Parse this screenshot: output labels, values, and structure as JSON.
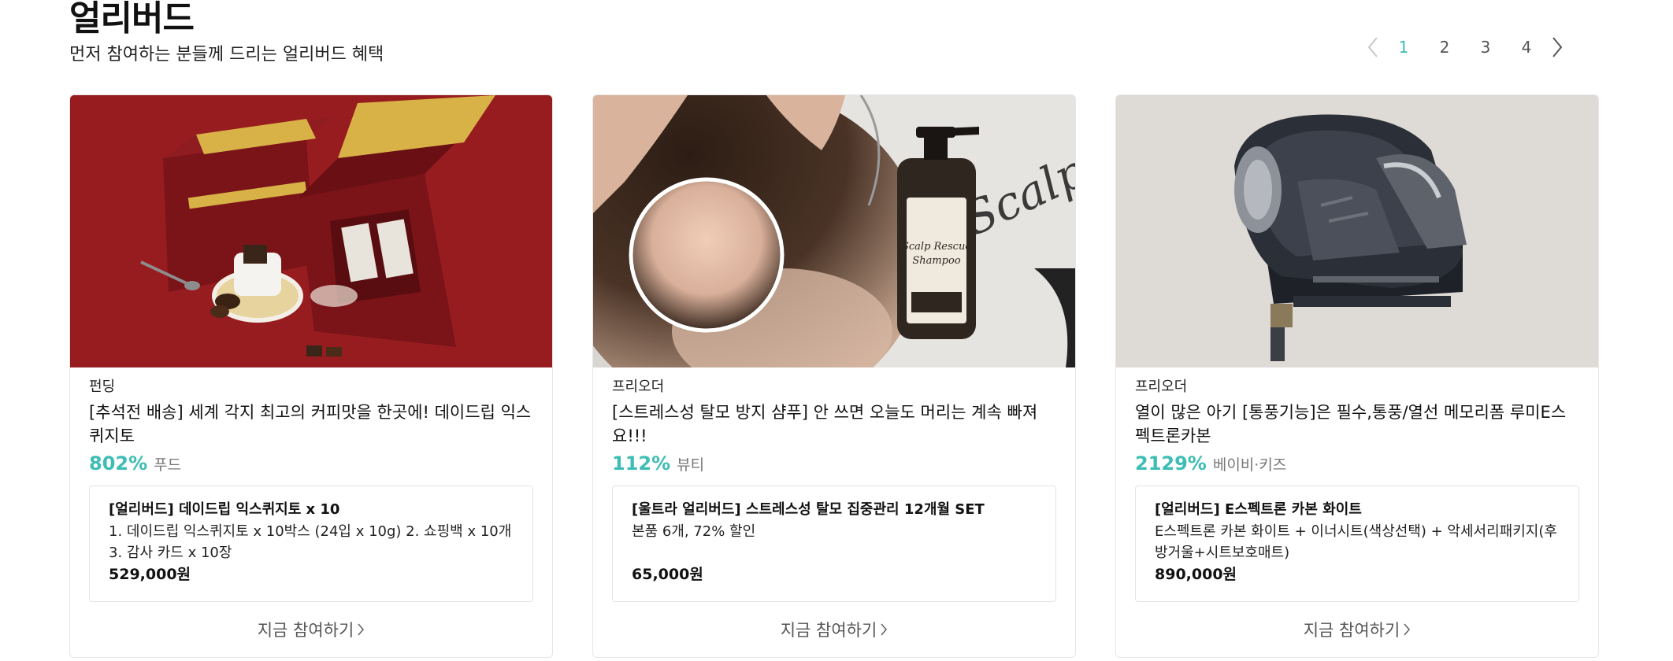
{
  "section": {
    "title": "얼리버드",
    "subtitle": "먼저 참여하는 분들께 드리는 얼리버드 혜택"
  },
  "pagination": {
    "pages": [
      "1",
      "2",
      "3",
      "4"
    ],
    "current": "1",
    "prev_icon": "chevron-left-icon",
    "next_icon": "chevron-right-icon"
  },
  "cards": [
    {
      "maker": "펀딩",
      "title": "[추석전 배송] 세계 각지 최고의 커피맛을 한곳에! 데이드립 익스퀴지토",
      "percent": "802%",
      "category": "푸드",
      "reward_name": "[얼리버드] 데이드립 익스퀴지토 x 10",
      "reward_desc": "1. 데이드립 익스퀴지토 x 10박스 (24입 x 10g) 2. 쇼핑백 x 10개 3. 감사 카드 x 10장",
      "reward_price": "529,000원",
      "cta": "지금 참여하기"
    },
    {
      "maker": "프리오더",
      "title": "[스트레스성 탈모 방지 샴푸] 안 쓰면 오늘도 머리는 계속 빠져요!!!",
      "percent": "112%",
      "category": "뷰티",
      "reward_name": "[울트라 얼리버드] 스트레스성 탈모 집중관리 12개월 SET",
      "reward_desc": "본품 6개, 72% 할인",
      "reward_price": "65,000원",
      "cta": "지금 참여하기",
      "image_text": {
        "bottle": "Scalp Rescue Shampoo",
        "background": "Scalp R Sham"
      }
    },
    {
      "maker": "프리오더",
      "title": "열이 많은 아기 [통풍기능]은 필수,통풍/열선 메모리폼 루미E스펙트론카본",
      "percent": "2129%",
      "category": "베이비·키즈",
      "reward_name": "[얼리버드] E스펙트론 카본 화이트",
      "reward_desc": "E스펙트론 카본 화이트 + 이너시트(색상선택) + 악세서리패키지(후방거울+시트보호매트)",
      "reward_price": "890,000원",
      "cta": "지금 참여하기"
    }
  ],
  "colors": {
    "accent": "#3dbdb5",
    "coffee_bg": "#9e1f23",
    "box_red": "#7a1418",
    "gold": "#d8b247",
    "shampoo_bg": "#d8d6d3",
    "seat_bg": "#dedad6",
    "seat_dark": "#2b2f37"
  }
}
